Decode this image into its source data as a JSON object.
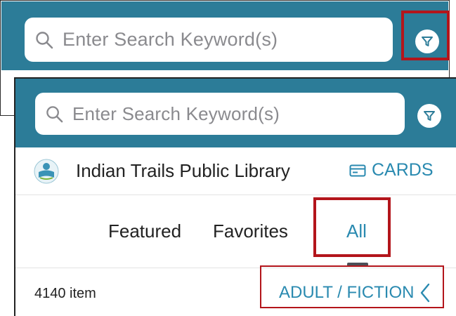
{
  "back_screen": {
    "search": {
      "placeholder": "Enter Search Keyword(s)"
    }
  },
  "front_screen": {
    "search": {
      "placeholder": "Enter Search Keyword(s)"
    },
    "library": {
      "name": "Indian Trails Public Library",
      "cards_label": "CARDS"
    },
    "tabs": [
      {
        "label": "Featured",
        "selected": false
      },
      {
        "label": "Favorites",
        "selected": false
      },
      {
        "label": "All",
        "selected": true
      }
    ],
    "results": {
      "count_text": "4140 item",
      "filter_path": "ADULT / FICTION"
    }
  },
  "icons": [
    "search-icon",
    "filter-icon",
    "library-logo-icon",
    "card-icon",
    "chevron-left-icon"
  ],
  "colors": {
    "header": "#2c7c98",
    "accent": "#2a8ab0",
    "highlight": "#b3151b",
    "placeholder": "#8a8a8e"
  }
}
